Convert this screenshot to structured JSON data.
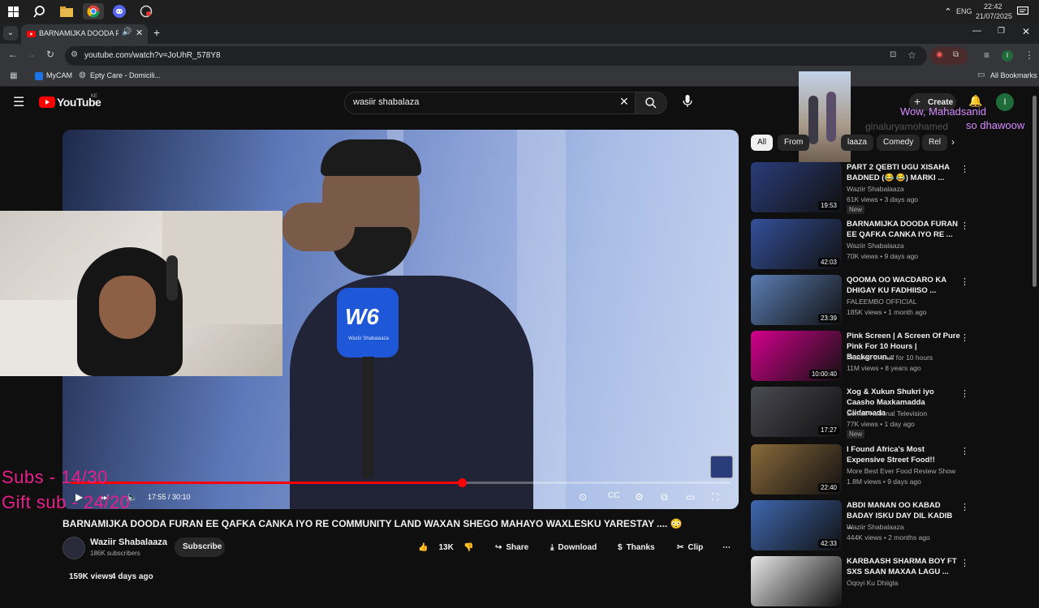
{
  "taskbar": {
    "lang": "ENG",
    "time": "22:42",
    "date": "21/07/2025"
  },
  "browser": {
    "tab_title": "BARNAMIJKA DOODA FURAN",
    "new_tab": "+",
    "url": "youtube.com/watch?v=JoUhR_578Y8",
    "bookmarks": [
      "MyCAM",
      "Epty Care - Domicili..."
    ],
    "all_bookmarks": "All Bookmarks",
    "profile_initial": "I"
  },
  "youtube": {
    "logo_text": "YouTube",
    "country": "KE",
    "search_value": "wasiir shabalaza",
    "create_label": "Create",
    "avatar_initial": "I"
  },
  "chat_overlay": {
    "line1": "Wow, Mahadsanid",
    "line2": "so dhawoow",
    "ghost": "ginaluryamohamed"
  },
  "stream_overlay": {
    "subs": "Subs - 14/30",
    "gift": "Gift sub - 24/20"
  },
  "player": {
    "time": "17:55 / 30:10",
    "progress": 0.593,
    "mic_brand": "Waziir Shabalaaza"
  },
  "chips": [
    "All",
    "From",
    "laaza",
    "Comedy",
    "Rel"
  ],
  "video": {
    "title": "BARNAMIJKA DOODA FURAN EE QAFKA CANKA IYO RE COMMUNITY LAND WAXAN SHEGO MAHAYO WAXLESKU YARESTAY .... 😳",
    "channel": "Waziir Shabalaaza",
    "subscribers": "186K subscribers",
    "subscribe_label": "Subscribe",
    "likes": "13K",
    "share_label": "Share",
    "download_label": "Download",
    "thanks_label": "Thanks",
    "clip_label": "Clip",
    "views": "159K views",
    "age": "4 days ago"
  },
  "recommendations": [
    {
      "title": "PART 2 QEBTI UGU XISAHA BADNED (😂 😂) MARKI ...",
      "channel": "Waziir Shabalaaza",
      "meta": "61K views • 3 days ago",
      "badge": "New",
      "duration": "19:53",
      "color": "#2a3d7a"
    },
    {
      "title": "BARNAMIJKA DOODA FURAN EE QAFKA CANKA IYO RE ...",
      "channel": "Waziir Shabalaaza",
      "meta": "70K views • 9 days ago",
      "badge": "",
      "duration": "42:03",
      "color": "#34509a"
    },
    {
      "title": "QOOMA OO WACDARO KA DHIGAY KU FADHIISO ...",
      "channel": "FALEEMBO OFFICIAL",
      "meta": "185K views • 1 month ago",
      "badge": "",
      "duration": "23:39",
      "color": "#5b7fb5"
    },
    {
      "title": "Pink Screen | A Screen Of Pure Pink For 10 Hours | Backgroun...",
      "channel": "Pictures of stuff for 10 hours",
      "meta": "11M views • 8 years ago",
      "badge": "",
      "duration": "10:00:40",
      "color": "#d4008c"
    },
    {
      "title": "Xog & Xukun Shukri iyo Caasho Maxkamadda Ciidamada",
      "channel": "Somali National Television",
      "meta": "77K views • 1 day ago",
      "badge": "New",
      "duration": "17:27",
      "color": "#4a4a52"
    },
    {
      "title": "I Found Africa's Most Expensive Street Food!!",
      "channel": "More Best Ever Food Review Show",
      "meta": "1.8M views • 9 days ago",
      "badge": "",
      "duration": "22:40",
      "color": "#8a6a3a"
    },
    {
      "title": "ABDI MANAN OO KABAD BADAY ISKU DAY DIL KADIB ...",
      "channel": "Waziir Shabalaaza",
      "meta": "444K views • 2 months ago",
      "badge": "",
      "duration": "42:33",
      "color": "#3f68b0"
    },
    {
      "title": "KARBAASH SHARMA BOY FT SXS SAAN MAXAA LAGU ...",
      "channel": "Oqoyi Ku Dhiigla",
      "meta": "",
      "badge": "",
      "duration": "",
      "color": "#e8e8e8"
    }
  ]
}
